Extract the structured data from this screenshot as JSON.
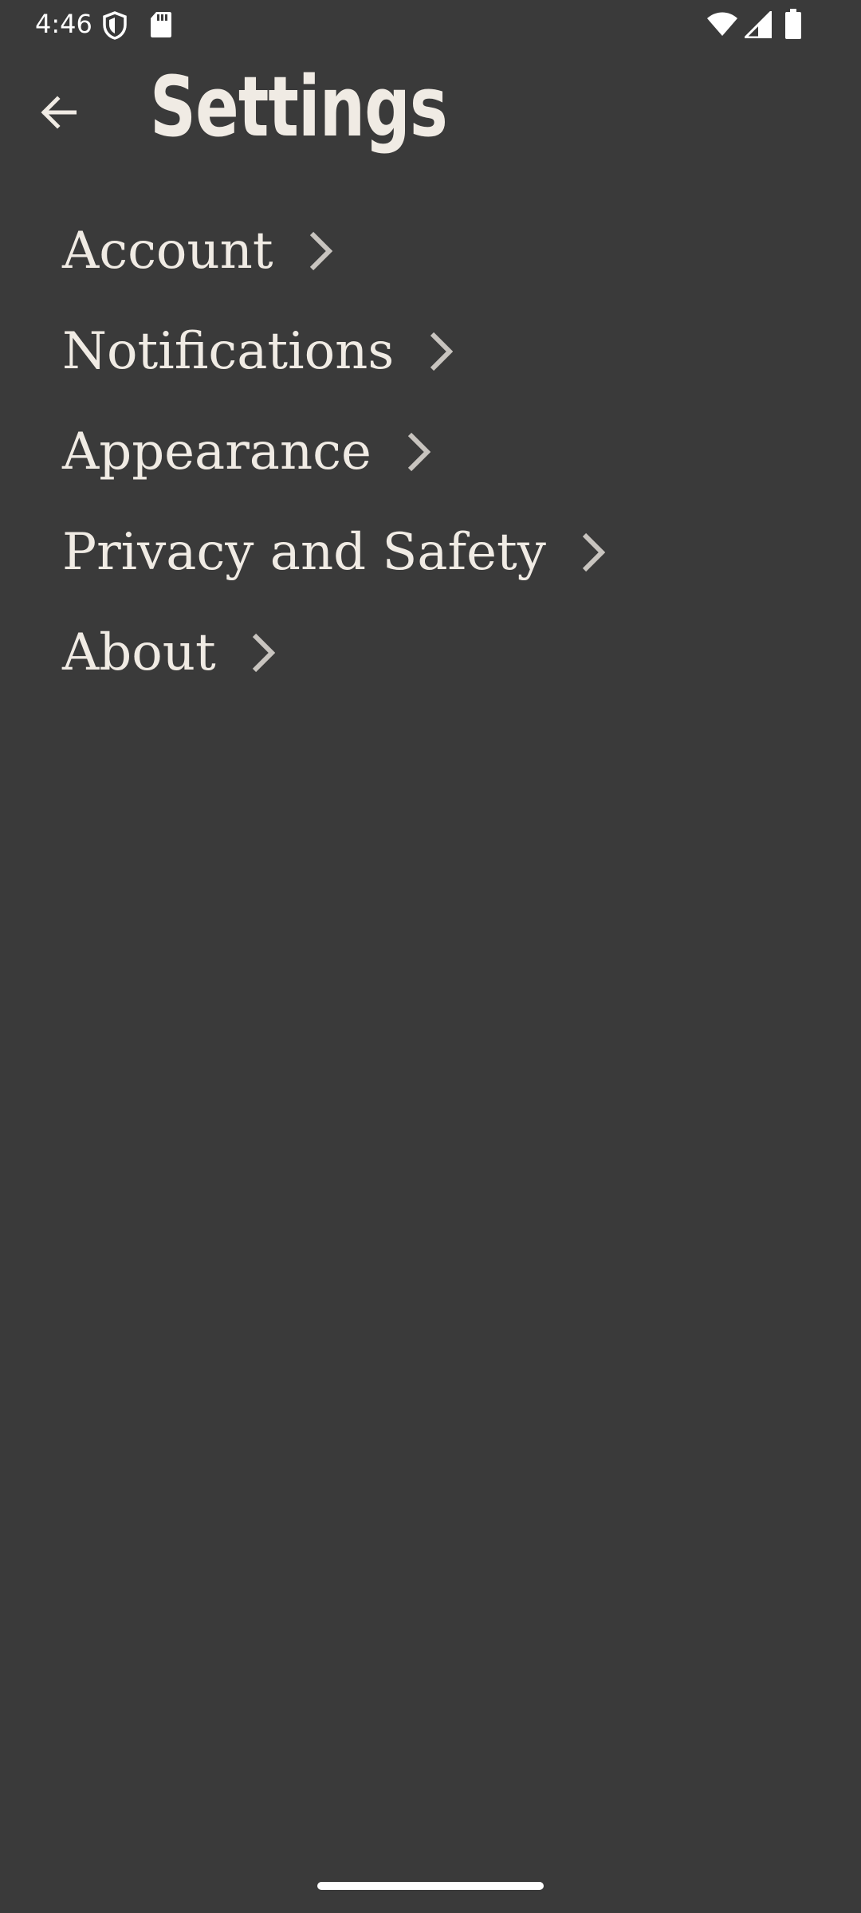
{
  "status_bar": {
    "time": "4:46",
    "left_icons": [
      "shield-icon",
      "sd-card-icon"
    ],
    "right_icons": [
      "wifi-icon",
      "cellular-signal-icon",
      "battery-icon"
    ]
  },
  "app_bar": {
    "back_icon": "arrow-back-icon",
    "title": "Settings"
  },
  "settings": {
    "items": [
      {
        "label": "Account",
        "icon": "chevron-right-icon"
      },
      {
        "label": "Notifications",
        "icon": "chevron-right-icon"
      },
      {
        "label": "Appearance",
        "icon": "chevron-right-icon"
      },
      {
        "label": "Privacy and Safety",
        "icon": "chevron-right-icon"
      },
      {
        "label": "About",
        "icon": "chevron-right-icon"
      }
    ]
  },
  "colors": {
    "background": "#3a3a3a",
    "text": "#f0ebe4",
    "chevron": "#c8c4bf"
  }
}
